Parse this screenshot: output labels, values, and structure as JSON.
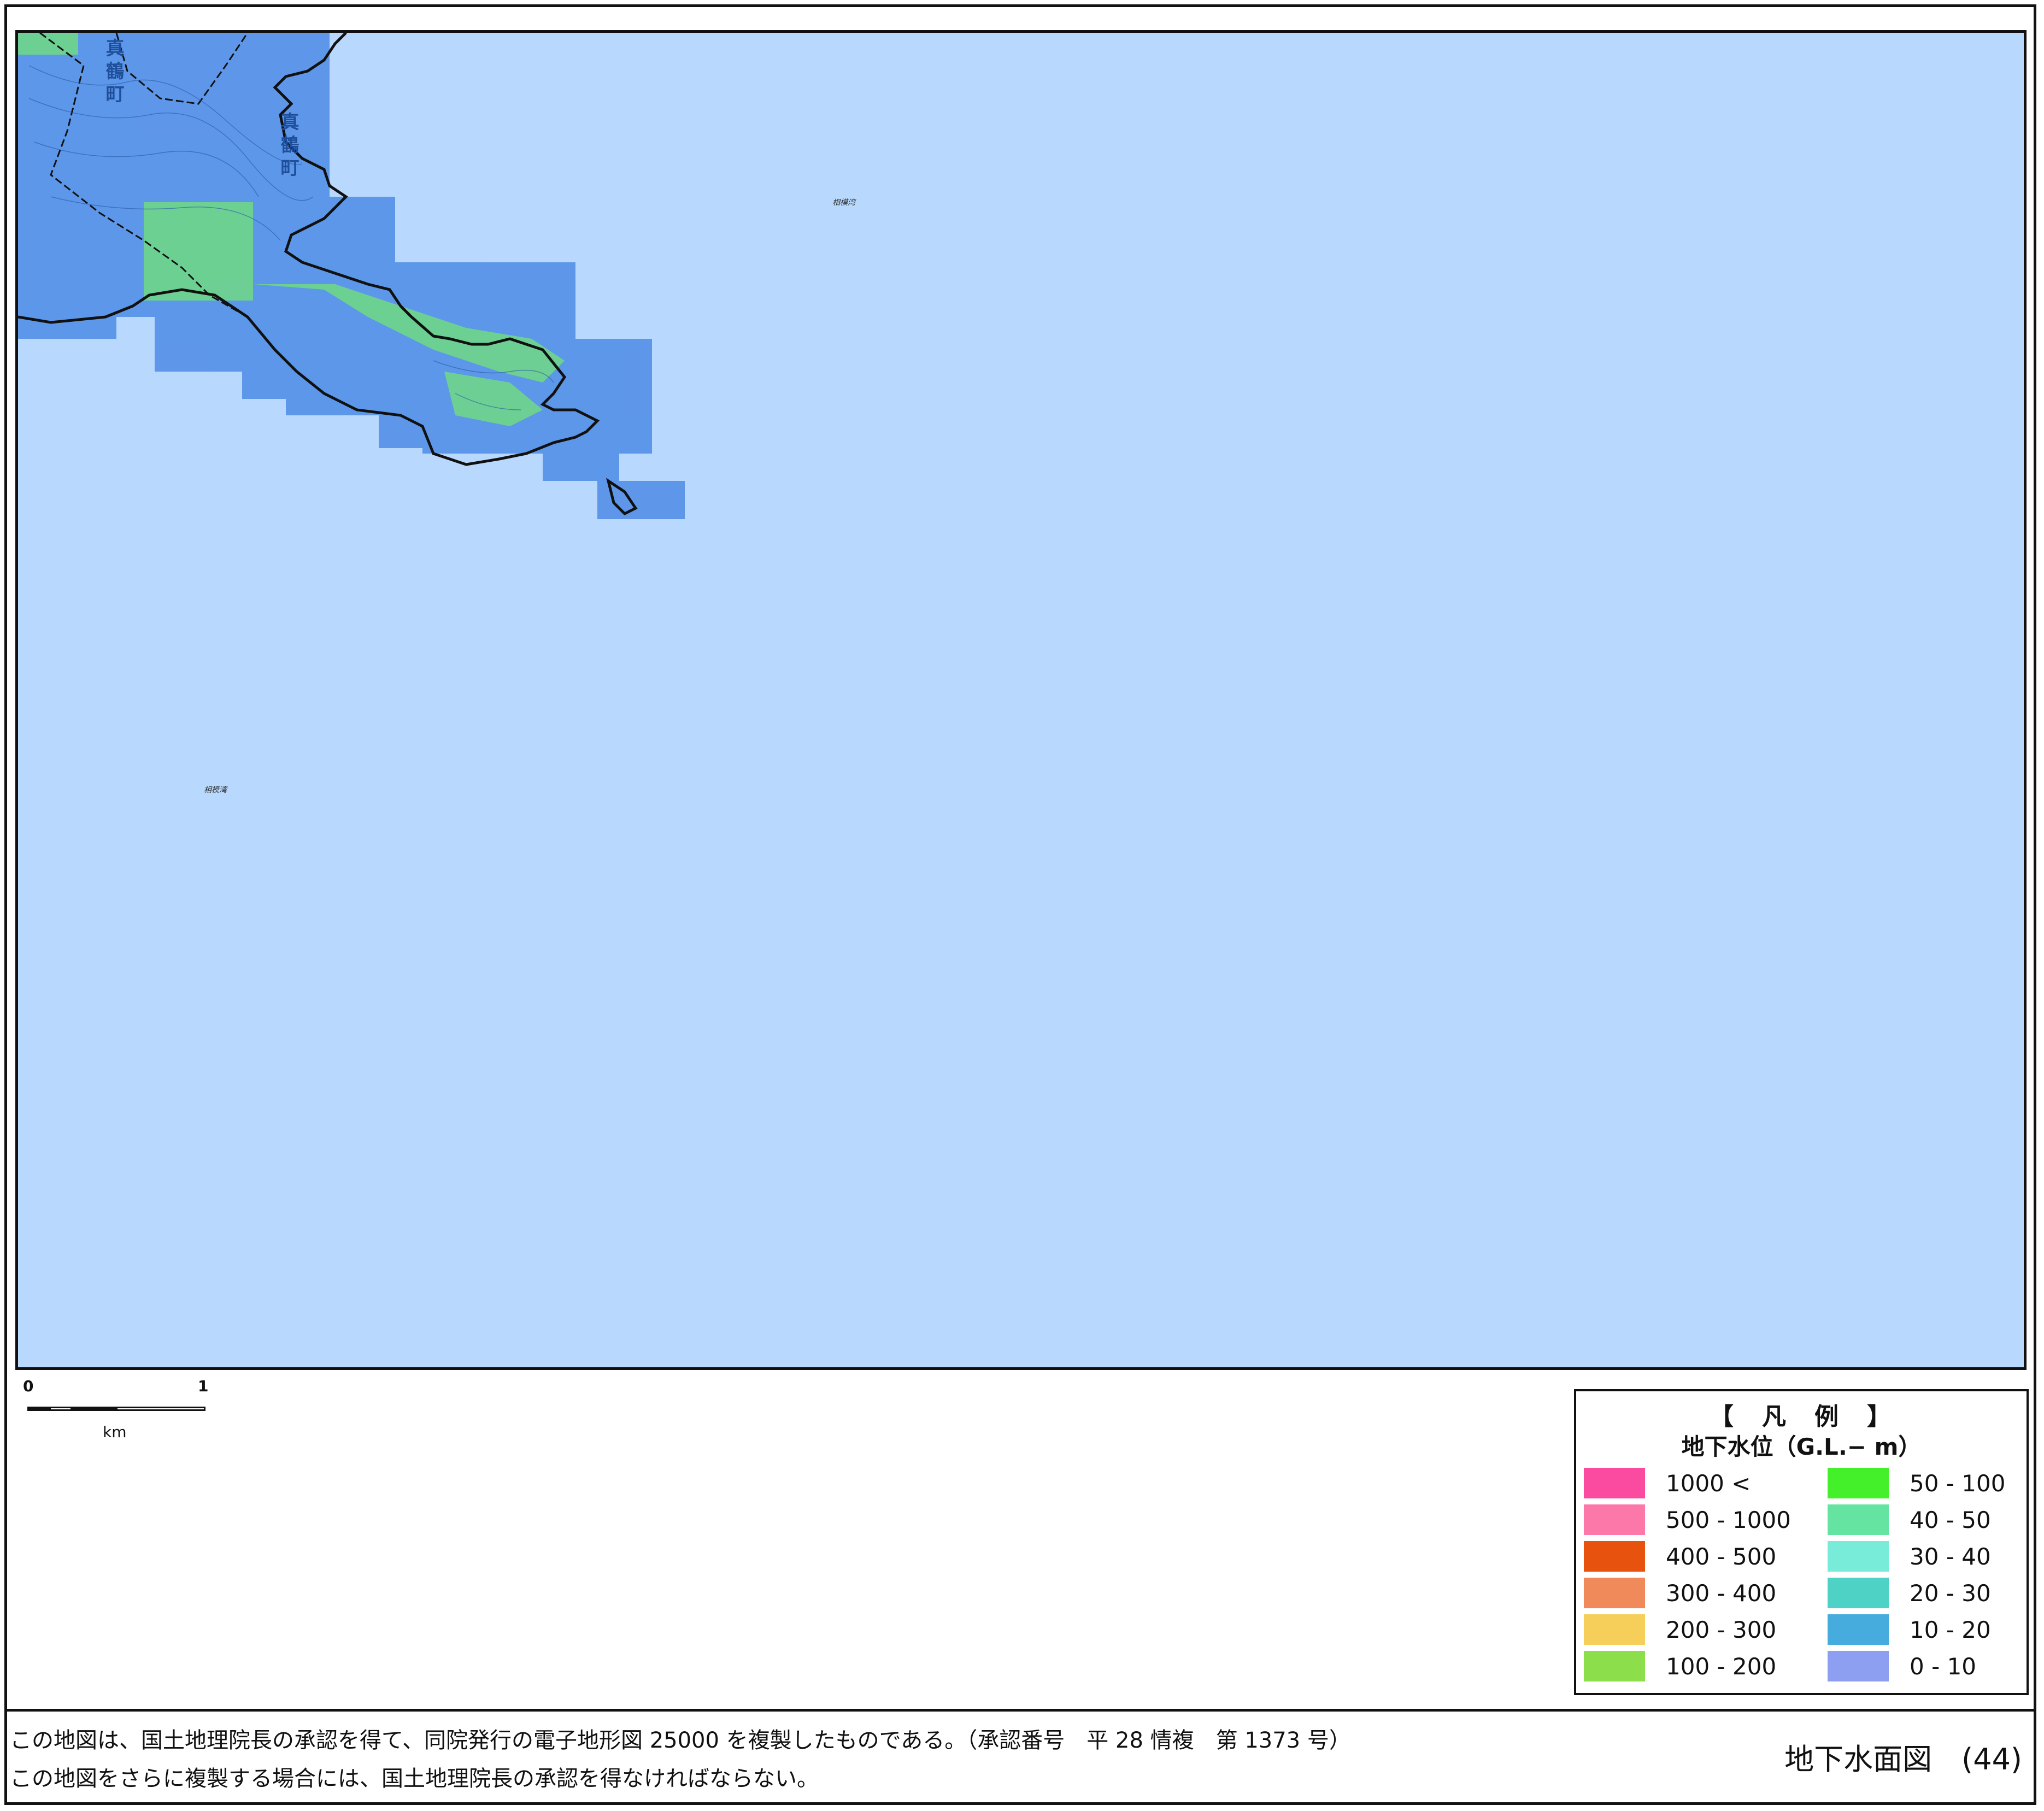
{
  "map": {
    "places": {
      "sagami_bay_1": "相模湾",
      "sagami_bay_2": "相模湾",
      "manazuru_town_1": "真鶴町",
      "manazuru_town_2": "真鶴町"
    },
    "sea_color": "#b8d8fd",
    "land_color": "#4d8ce6",
    "land_color_green": "#6fd68a"
  },
  "scale": {
    "zero": "0",
    "one": "1",
    "unit": "km"
  },
  "legend": {
    "title": "【　凡　例　】",
    "subtitle": "地下水位（G.L.− m）",
    "items": [
      {
        "label": "1000 <",
        "color": "#fa4ba0"
      },
      {
        "label": "500 - 1000",
        "color": "#fb78a8"
      },
      {
        "label": "400 - 500",
        "color": "#e8520f"
      },
      {
        "label": "300 - 400",
        "color": "#f08a5a"
      },
      {
        "label": "200 - 300",
        "color": "#f5cf5a"
      },
      {
        "label": "100 - 200",
        "color": "#8cde4a"
      },
      {
        "label": "50 - 100",
        "color": "#44f02a"
      },
      {
        "label": "40 - 50",
        "color": "#64e4a0"
      },
      {
        "label": "30 - 40",
        "color": "#78ecd8"
      },
      {
        "label": "20 - 30",
        "color": "#4ed2c6"
      },
      {
        "label": "10 - 20",
        "color": "#46acde"
      },
      {
        "label": "0 - 10",
        "color": "#8c9ff0"
      }
    ]
  },
  "footer": {
    "line1": "この地図は、国土地理院長の承認を得て、同院発行の電子地形図 25000 を複製したものである。（承認番号　平 28 情複　第 1373 号）",
    "line2": "この地図をさらに複製する場合には、国土地理院長の承認を得なければならない。",
    "title": "地下水面図　(44)"
  }
}
